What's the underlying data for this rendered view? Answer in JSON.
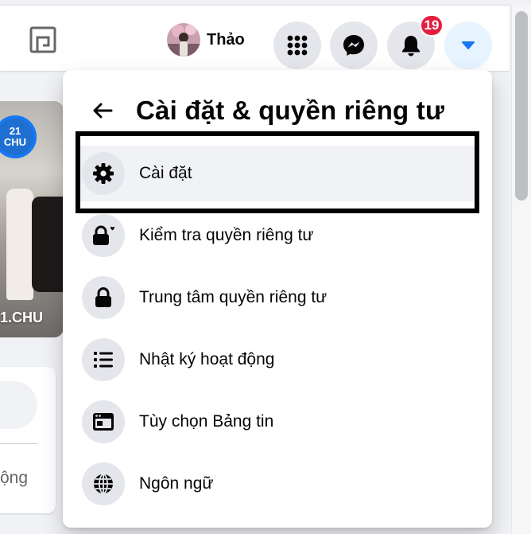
{
  "topbar": {
    "profile_name": "Thảo",
    "notification_count": "19",
    "icons": {
      "gaming": "gaming-icon",
      "menu": "grid-menu-icon",
      "messenger": "messenger-icon",
      "notifications": "bell-icon",
      "account": "caret-down-icon"
    }
  },
  "background": {
    "story_ring_text": "21\nCHU",
    "story_label": "1.CHU",
    "card_text": "ộng"
  },
  "dropdown": {
    "title": "Cài đặt & quyền riêng tư",
    "items": [
      {
        "label": "Cài đặt",
        "icon": "gear-icon"
      },
      {
        "label": "Kiểm tra quyền riêng tư",
        "icon": "lock-heart-icon"
      },
      {
        "label": "Trung tâm quyền riêng tư",
        "icon": "lock-icon"
      },
      {
        "label": "Nhật ký hoạt động",
        "icon": "list-icon"
      },
      {
        "label": "Tùy chọn Bảng tin",
        "icon": "news-feed-icon"
      },
      {
        "label": "Ngôn ngữ",
        "icon": "globe-icon"
      }
    ]
  },
  "colors": {
    "accent": "#1877f2",
    "badge": "#e41e3f",
    "icon_circle": "#e4e6eb",
    "hover": "#f0f2f5"
  }
}
